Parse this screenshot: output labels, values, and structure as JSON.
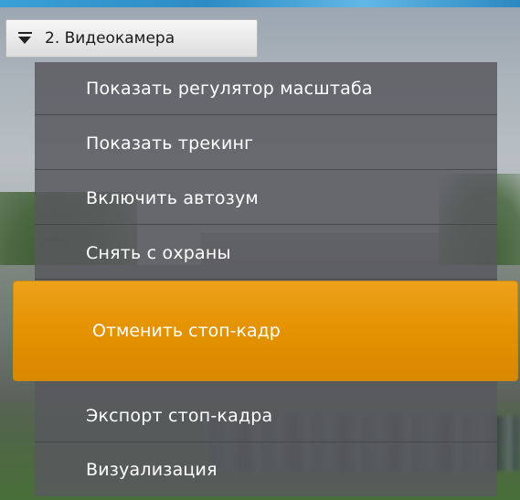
{
  "camera": {
    "label": "2. Видеокамера",
    "icon": "dropdown-arrow-icon"
  },
  "menu": {
    "items": [
      {
        "label": "Показать регулятор масштаба"
      },
      {
        "label": "Показать трекинг"
      },
      {
        "label": "Включить автозум"
      },
      {
        "label": "Снять с охраны"
      },
      {
        "label": "Отменить стоп-кадр",
        "highlighted": true
      },
      {
        "label": "Экспорт стоп-кадра"
      },
      {
        "label": "Визуализация"
      }
    ]
  },
  "colors": {
    "highlight": "#e39200",
    "menu_background": "#58585e",
    "text": "#ffffff"
  }
}
